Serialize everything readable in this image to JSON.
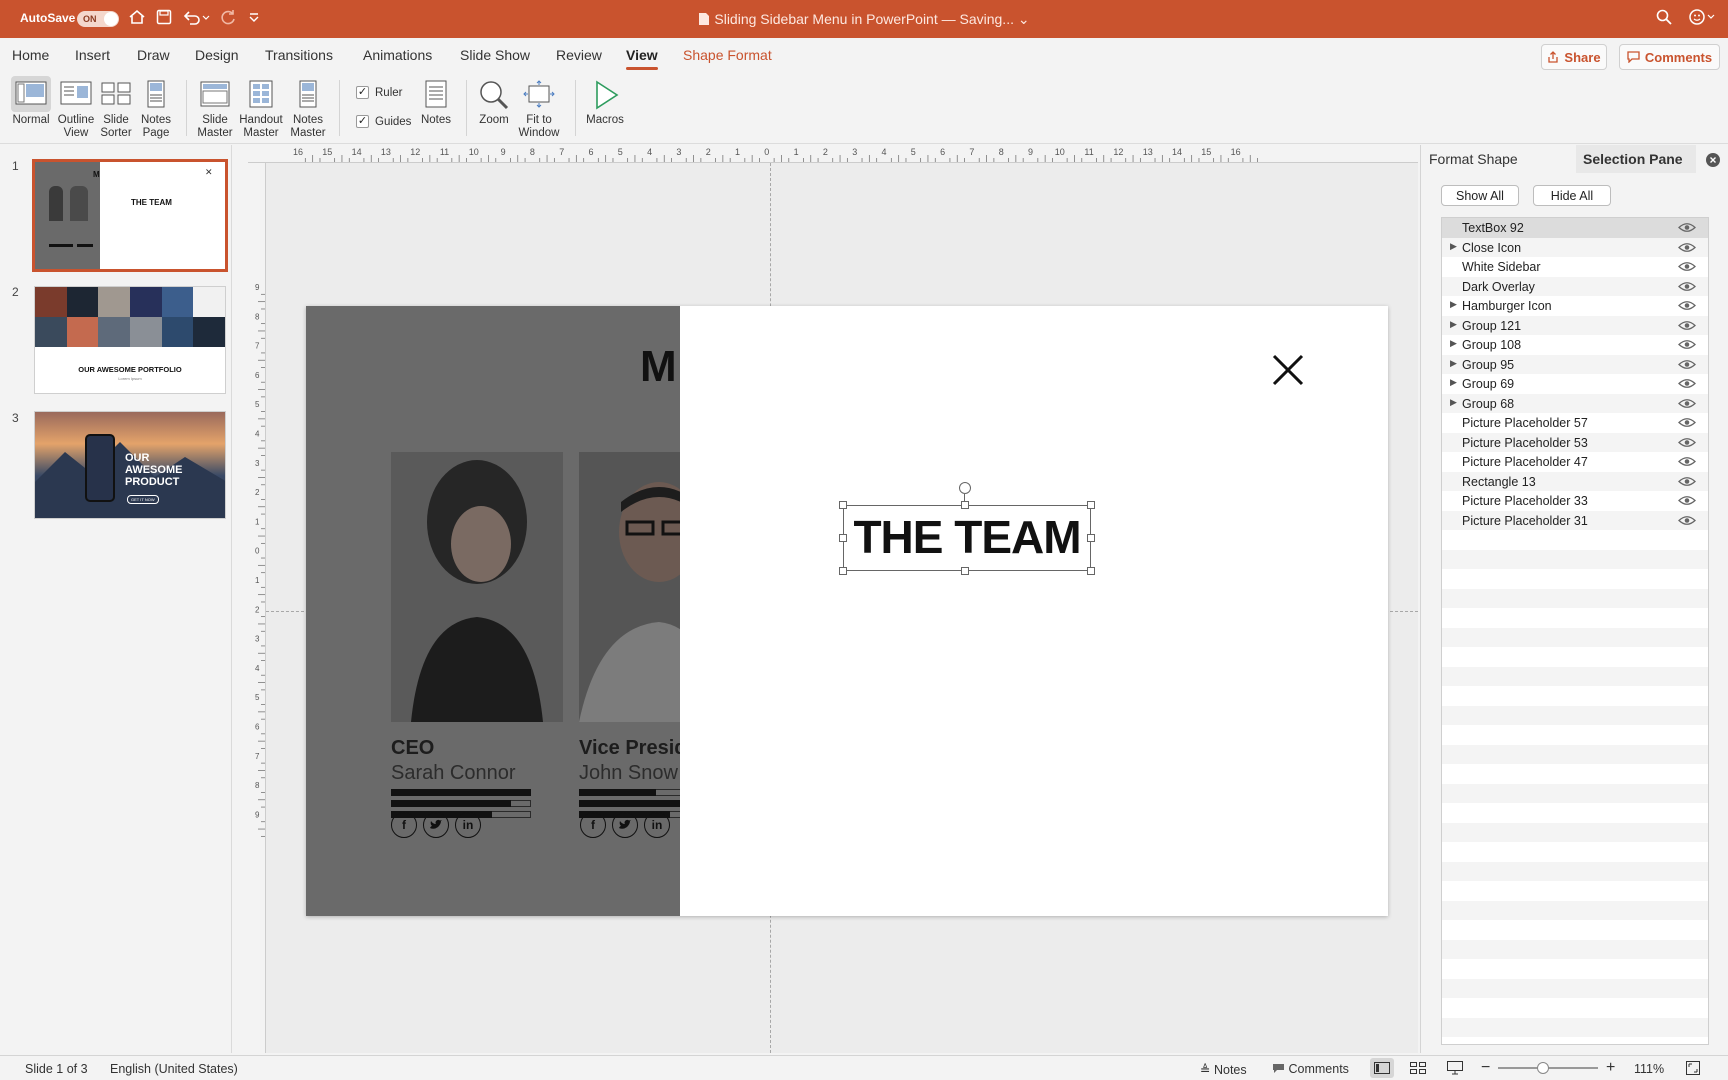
{
  "titlebar": {
    "autosave_label": "AutoSave",
    "autosave_state": "ON",
    "document_title": "Sliding Sidebar Menu in PowerPoint — Saving...",
    "title_chevron": "⌄",
    "icons": [
      "home-icon",
      "save-icon",
      "undo-icon",
      "redo-icon",
      "customize-icon",
      "search-icon",
      "account-icon"
    ]
  },
  "ribbon_tabs": [
    "Home",
    "Insert",
    "Draw",
    "Design",
    "Transitions",
    "Animations",
    "Slide Show",
    "Review",
    "View",
    "Shape Format"
  ],
  "active_tab": "View",
  "top_buttons": {
    "share": "Share",
    "comments": "Comments"
  },
  "ribbon": {
    "normal": "Normal",
    "outline_view": [
      "Outline",
      "View"
    ],
    "slide_sorter": [
      "Slide",
      "Sorter"
    ],
    "notes_page": [
      "Notes",
      "Page"
    ],
    "slide_master": [
      "Slide",
      "Master"
    ],
    "handout_master": [
      "Handout",
      "Master"
    ],
    "notes_master": [
      "Notes",
      "Master"
    ],
    "ruler": "Ruler",
    "guides": "Guides",
    "notes": "Notes",
    "zoom": "Zoom",
    "fit_to_window": [
      "Fit to",
      "Window"
    ],
    "macros": "Macros"
  },
  "thumbnails": [
    {
      "number": "1",
      "title": "THE TEAM",
      "selected": true
    },
    {
      "number": "2",
      "title": "OUR AWESOME PORTFOLIO",
      "subtitle": "Lorem Ipsum"
    },
    {
      "number": "3",
      "title_lines": [
        "OUR",
        "AWESOME",
        "PRODUCT"
      ],
      "cta": "GET IT NOW"
    }
  ],
  "ruler_top": [
    "16",
    "15",
    "14",
    "13",
    "12",
    "11",
    "10",
    "9",
    "8",
    "7",
    "6",
    "5",
    "4",
    "3",
    "2",
    "1",
    "0",
    "1",
    "2",
    "3",
    "4",
    "5",
    "6",
    "7",
    "8",
    "9",
    "10",
    "11",
    "12",
    "13",
    "14",
    "15",
    "16"
  ],
  "ruler_left": [
    "9",
    "8",
    "7",
    "6",
    "5",
    "4",
    "3",
    "2",
    "1",
    "0",
    "1",
    "2",
    "3",
    "4",
    "5",
    "6",
    "7",
    "8",
    "9"
  ],
  "slide": {
    "menu_letter": "M",
    "heading": "THE TEAM",
    "close_glyph": "✕",
    "members": [
      {
        "title": "CEO",
        "name": "Sarah Connor",
        "skills": [
          1.0,
          0.86,
          0.72
        ]
      },
      {
        "title": "Vice Preside",
        "name": "John Snow",
        "skills": [
          0.55,
          0.8,
          0.65
        ]
      }
    ],
    "social": [
      "f",
      "t",
      "in"
    ]
  },
  "selection_pane": {
    "tab_format": "Format Shape",
    "tab_selection": "Selection Pane",
    "show_all": "Show All",
    "hide_all": "Hide All",
    "items": [
      {
        "name": "TextBox 92",
        "group": false,
        "selected": true
      },
      {
        "name": "Close Icon",
        "group": true
      },
      {
        "name": "White Sidebar",
        "group": false
      },
      {
        "name": "Dark Overlay",
        "group": false
      },
      {
        "name": "Hamburger Icon",
        "group": true
      },
      {
        "name": "Group 121",
        "group": true
      },
      {
        "name": "Group 108",
        "group": true
      },
      {
        "name": "Group 95",
        "group": true
      },
      {
        "name": "Group 69",
        "group": true
      },
      {
        "name": "Group 68",
        "group": true
      },
      {
        "name": "Picture Placeholder 57",
        "group": false
      },
      {
        "name": "Picture Placeholder 53",
        "group": false
      },
      {
        "name": "Picture Placeholder 47",
        "group": false
      },
      {
        "name": "Rectangle 13",
        "group": false
      },
      {
        "name": "Picture Placeholder 33",
        "group": false
      },
      {
        "name": "Picture Placeholder 31",
        "group": false
      }
    ]
  },
  "status": {
    "slide_of": "Slide 1 of 3",
    "language": "English (United States)",
    "notes": "Notes",
    "comments": "Comments",
    "zoom_minus": "−",
    "zoom_plus": "+",
    "zoom": "111%",
    "zoom_level": 0.45
  },
  "colors": {
    "accent": "#c9532e",
    "overlay": "#6a6a6a"
  }
}
